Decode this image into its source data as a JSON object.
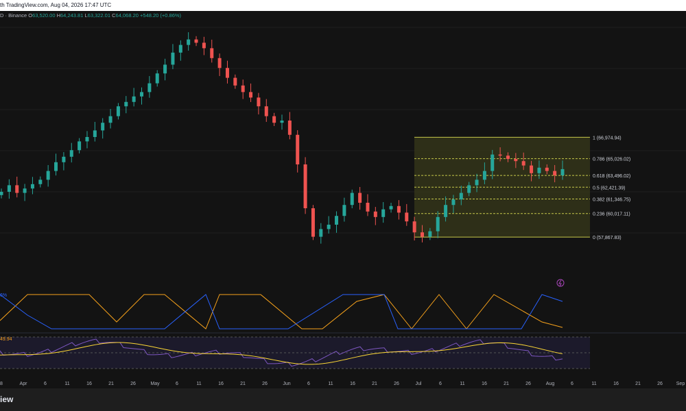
{
  "header": {
    "title": "th TradingView.com, Aug 04, 2026 17:47 UTC",
    "symbol": "D · Binance",
    "o_label": "O",
    "o_value": "63,520.00",
    "h_label": "H",
    "h_value": "64,243.81",
    "l_label": "L",
    "l_value": "63,322.01",
    "c_label": "C",
    "c_value": "64,068.20",
    "change": "+548.20 (+0.86%)"
  },
  "fib_labels": [
    "1 (66,974.94)",
    "0.786 (65,026.02)",
    "0.618 (63,496.02)",
    "0.5 (62,421.39)",
    "0.382 (61,346.75)",
    "0.236 (60,017.11)",
    "0 (57,867.83)"
  ],
  "indicator": {
    "aroon_value": "6%",
    "rsi_value": "49.94"
  },
  "x_axis": [
    "8",
    "Apr",
    "6",
    "11",
    "16",
    "21",
    "26",
    "May",
    "6",
    "11",
    "16",
    "21",
    "26",
    "Jun",
    "6",
    "11",
    "16",
    "21",
    "26",
    "Jul",
    "6",
    "11",
    "16",
    "21",
    "26",
    "Aug",
    "6",
    "11",
    "16",
    "21",
    "26",
    "Sep"
  ],
  "footer": {
    "brand": "iew"
  },
  "colors": {
    "up": "#26a69a",
    "down": "#ef5350",
    "fib_line": "#c7c94a",
    "fib_fill": "#34351a",
    "aroon_up": "#f7a21b",
    "aroon_down": "#2962ff",
    "rsi_line": "#7e57c2",
    "rsi_ma": "#fdd835"
  },
  "chart_data": {
    "type": "candlestick",
    "title": "",
    "price_points_close": [
      62000,
      62600,
      61900,
      62300,
      62700,
      63100,
      63900,
      64700,
      65200,
      65800,
      66600,
      67000,
      67600,
      68300,
      68900,
      69800,
      70200,
      70700,
      71100,
      71900,
      72800,
      73600,
      74700,
      75400,
      75900,
      75600,
      75100,
      74200,
      73300,
      72400,
      71700,
      71100,
      70600,
      69800,
      68900,
      68300,
      68500,
      67200,
      64500,
      60500,
      57900,
      58600,
      59000,
      59800,
      60800,
      61900,
      61000,
      60200,
      59700,
      60400,
      60700,
      60100,
      59300,
      58300,
      57900,
      58400,
      59700,
      60800,
      61300,
      61900,
      62600,
      63100,
      63900,
      65400,
      65300,
      65000,
      64800,
      64400,
      63700,
      64200,
      63900,
      63500,
      64068
    ],
    "fib_retracement": {
      "levels": [
        1,
        0.786,
        0.618,
        0.5,
        0.382,
        0.236,
        0
      ],
      "prices": [
        66974.94,
        65026.02,
        63496.02,
        62421.39,
        61346.75,
        60017.11,
        57867.83
      ]
    },
    "aroon": {
      "up_value_pct": 6
    },
    "rsi": {
      "value": 49.94
    },
    "x_ticks": [
      "8",
      "Apr",
      "6",
      "11",
      "16",
      "21",
      "26",
      "May",
      "6",
      "11",
      "16",
      "21",
      "26",
      "Jun",
      "6",
      "11",
      "16",
      "21",
      "26",
      "Jul",
      "6",
      "11",
      "16",
      "21",
      "26",
      "Aug",
      "6",
      "11",
      "16",
      "21",
      "26",
      "Sep"
    ]
  }
}
